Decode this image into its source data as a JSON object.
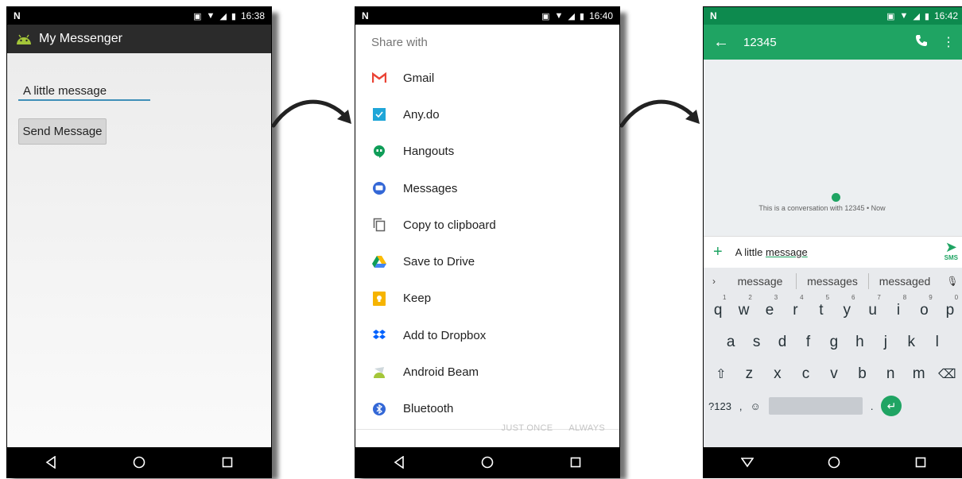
{
  "screen1": {
    "status": {
      "brand": "N",
      "time": "16:38"
    },
    "app_title": "My Messenger",
    "message_value": "A little message",
    "send_label": "Send Message"
  },
  "screen2": {
    "status": {
      "brand": "N",
      "time": "16:40"
    },
    "title": "Share with",
    "items": [
      {
        "label": "Gmail",
        "icon": "gmail-icon"
      },
      {
        "label": "Any.do",
        "icon": "anydo-icon"
      },
      {
        "label": "Hangouts",
        "icon": "hangouts-icon"
      },
      {
        "label": "Messages",
        "icon": "messages-icon"
      },
      {
        "label": "Copy to clipboard",
        "icon": "clipboard-icon"
      },
      {
        "label": "Save to Drive",
        "icon": "drive-icon"
      },
      {
        "label": "Keep",
        "icon": "keep-icon"
      },
      {
        "label": "Add to Dropbox",
        "icon": "dropbox-icon"
      },
      {
        "label": "Android Beam",
        "icon": "android-beam-icon"
      },
      {
        "label": "Bluetooth",
        "icon": "bluetooth-icon"
      }
    ],
    "just_once": "JUST ONCE",
    "always": "ALWAYS"
  },
  "screen3": {
    "status": {
      "brand": "N",
      "time": "16:42"
    },
    "conversation_title": "12345",
    "conversation_note": "This is a conversation with 12345 • Now",
    "compose_prefix": "A little ",
    "compose_underlined": "message",
    "send_sub": "SMS",
    "suggestions": [
      "message",
      "messages",
      "messaged"
    ],
    "row1_keys": [
      "q",
      "w",
      "e",
      "r",
      "t",
      "y",
      "u",
      "i",
      "o",
      "p"
    ],
    "row1_hints": [
      "1",
      "2",
      "3",
      "4",
      "5",
      "6",
      "7",
      "8",
      "9",
      "0"
    ],
    "row2_keys": [
      "a",
      "s",
      "d",
      "f",
      "g",
      "h",
      "j",
      "k",
      "l"
    ],
    "row3_keys": [
      "z",
      "x",
      "c",
      "v",
      "b",
      "n",
      "m"
    ],
    "symbols_key": "?123",
    "comma_key": ",",
    "period_key": "."
  },
  "colors": {
    "messenger_green": "#1fa463",
    "input_underline": "#3f8fb8",
    "gmail_red": "#ea4335",
    "anydo_blue": "#1fa6d8"
  }
}
